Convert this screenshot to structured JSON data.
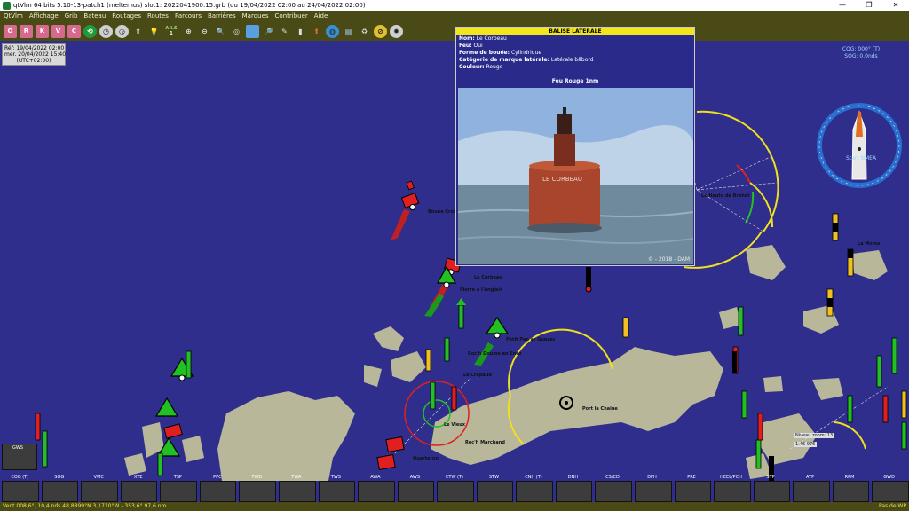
{
  "window": {
    "title": "qtVlm 64 bits 5.10-13-patch1 (meltemus) slot1: 2022041900.15.grb (du 19/04/2022 02:00 au 24/04/2022 02:00)",
    "minimize": "—",
    "maximize": "❐",
    "close": "✕"
  },
  "menu": [
    "QtVlm",
    "Affichage",
    "Grib",
    "Bateau",
    "Routages",
    "Routes",
    "Parcours",
    "Barrières",
    "Marques",
    "Contribuer",
    "Aide"
  ],
  "toolbar": {
    "letters": [
      "O",
      "R",
      "K",
      "V",
      "C"
    ],
    "ais_label": "A.I.S",
    "ais_value": "1"
  },
  "datebox": {
    "ref": "Réf: 19/04/2022 02:00",
    "current": "mer. 20/04/2022 15:40",
    "tz": "(UTC+02:00)"
  },
  "popup": {
    "title": "BALISE LATERALE",
    "fields": [
      {
        "label": "Nom:",
        "value": "Le Corbeau"
      },
      {
        "label": "Feu:",
        "value": "Oui"
      },
      {
        "label": "Forme de bouée:",
        "value": "Cylindrique"
      },
      {
        "label": "Catégorie de marque latérale:",
        "value": "Latérale bâbord"
      },
      {
        "label": "Couleur:",
        "value": "Rouge"
      }
    ],
    "light": "Feu Rouge   1nm",
    "photo_text": "LE CORBEAU",
    "credit": "© - 2018 - DAM"
  },
  "map_labels": {
    "bouee_croll": "Bouée Croll",
    "le_corbeau": "Le Corbeau",
    "pierre_anglais": "Pierre à l'Anglais",
    "petit_pen": "Petit Pen ar Guezec",
    "roc_h_doumo": "Roc'h Doumo an Enez",
    "le_crapaud": "Le Crapaud",
    "port_la_chaine": "Port la Chaine",
    "roc_h_marchand": "Roc'h Marchand",
    "le_vieux": "Le Vieux",
    "la_moine": "La Moine",
    "quarteron": "Quarteron",
    "niveau_zoom": "Niveau zoom: 13",
    "scale": "1:46 976",
    "haute_brehat": "Le Haute de Bréhat"
  },
  "compass": {
    "cog": "COG: 000° (T)",
    "sog": "SOG: 0.0nds",
    "start": "Start NMEA"
  },
  "instruments": {
    "gws": "GWS",
    "labels": [
      "COG (T)",
      "SOG",
      "VMC",
      "XTE",
      "TSP",
      "PPC",
      "TWD",
      "TWA",
      "TWS",
      "AWA",
      "AWS",
      "CTW (T)",
      "STW",
      "CNH (T)",
      "DNH",
      "CS/CD",
      "DPH",
      "PRE",
      "HEEL/PCH",
      "STP",
      "ATP",
      "RPM",
      "GWD"
    ]
  },
  "status": {
    "text": "Vent 008,6°, 10,4 nds 48,8899°N 3,1710°W - 353,6° 97,6 nm",
    "right": "Pas de WP"
  },
  "colors": {
    "sea": "#2f2e8c",
    "land": "#b9b79a",
    "menubar": "#4a4a16",
    "buoy_green": "#22c022",
    "buoy_red": "#e02020",
    "sector_yellow": "#f0e020"
  }
}
